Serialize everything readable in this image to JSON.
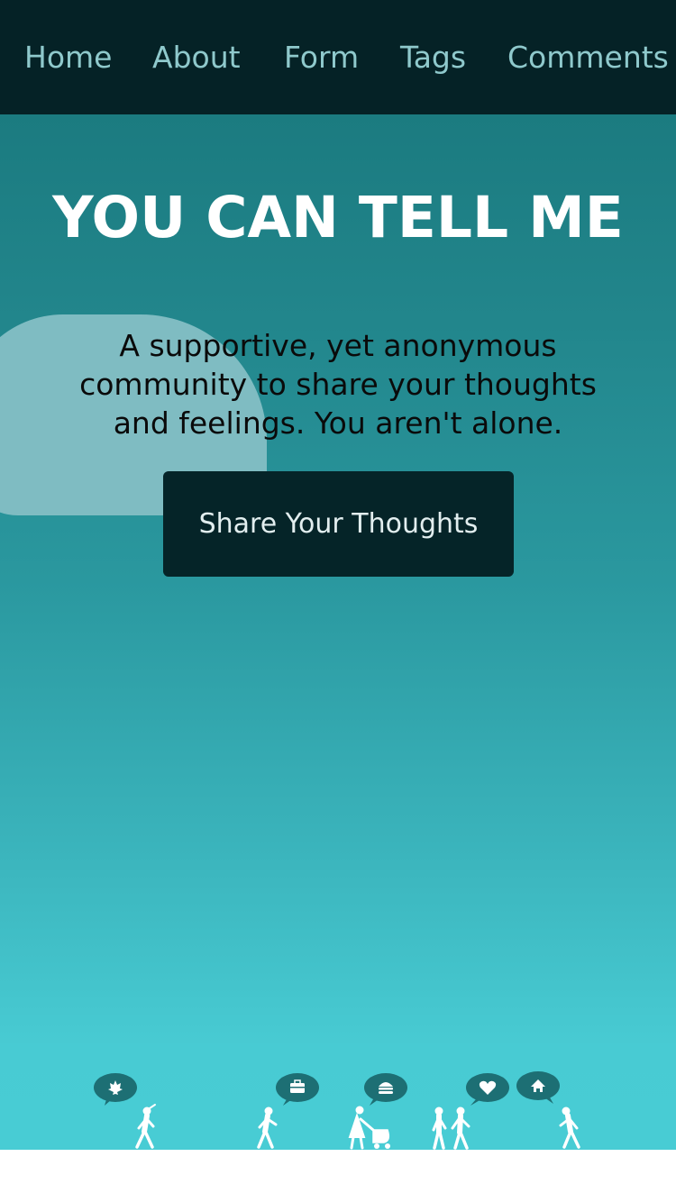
{
  "nav": {
    "items": [
      {
        "label": "Home"
      },
      {
        "label": "About"
      },
      {
        "label": "Form"
      },
      {
        "label": "Tags"
      },
      {
        "label": "Comments"
      }
    ]
  },
  "hero": {
    "title": "YOU CAN TELL ME",
    "tagline": "A supportive, yet anonymous community to share your thoughts and feelings. You aren't alone.",
    "cta_label": "Share Your Thoughts"
  },
  "illustration": {
    "bubbles": [
      {
        "icon": "maple-leaf-icon"
      },
      {
        "icon": "briefcase-icon"
      },
      {
        "icon": "burger-icon"
      },
      {
        "icon": "heart-icon"
      },
      {
        "icon": "home-icon"
      }
    ]
  },
  "colors": {
    "nav_bg": "#052226",
    "nav_text": "#8fc9cc",
    "hero_top": "#1b7b80",
    "hero_bottom": "#48ccd4",
    "button_bg": "#052428",
    "cloud": "#7fbcc2",
    "bubble": "#1d6f74"
  }
}
